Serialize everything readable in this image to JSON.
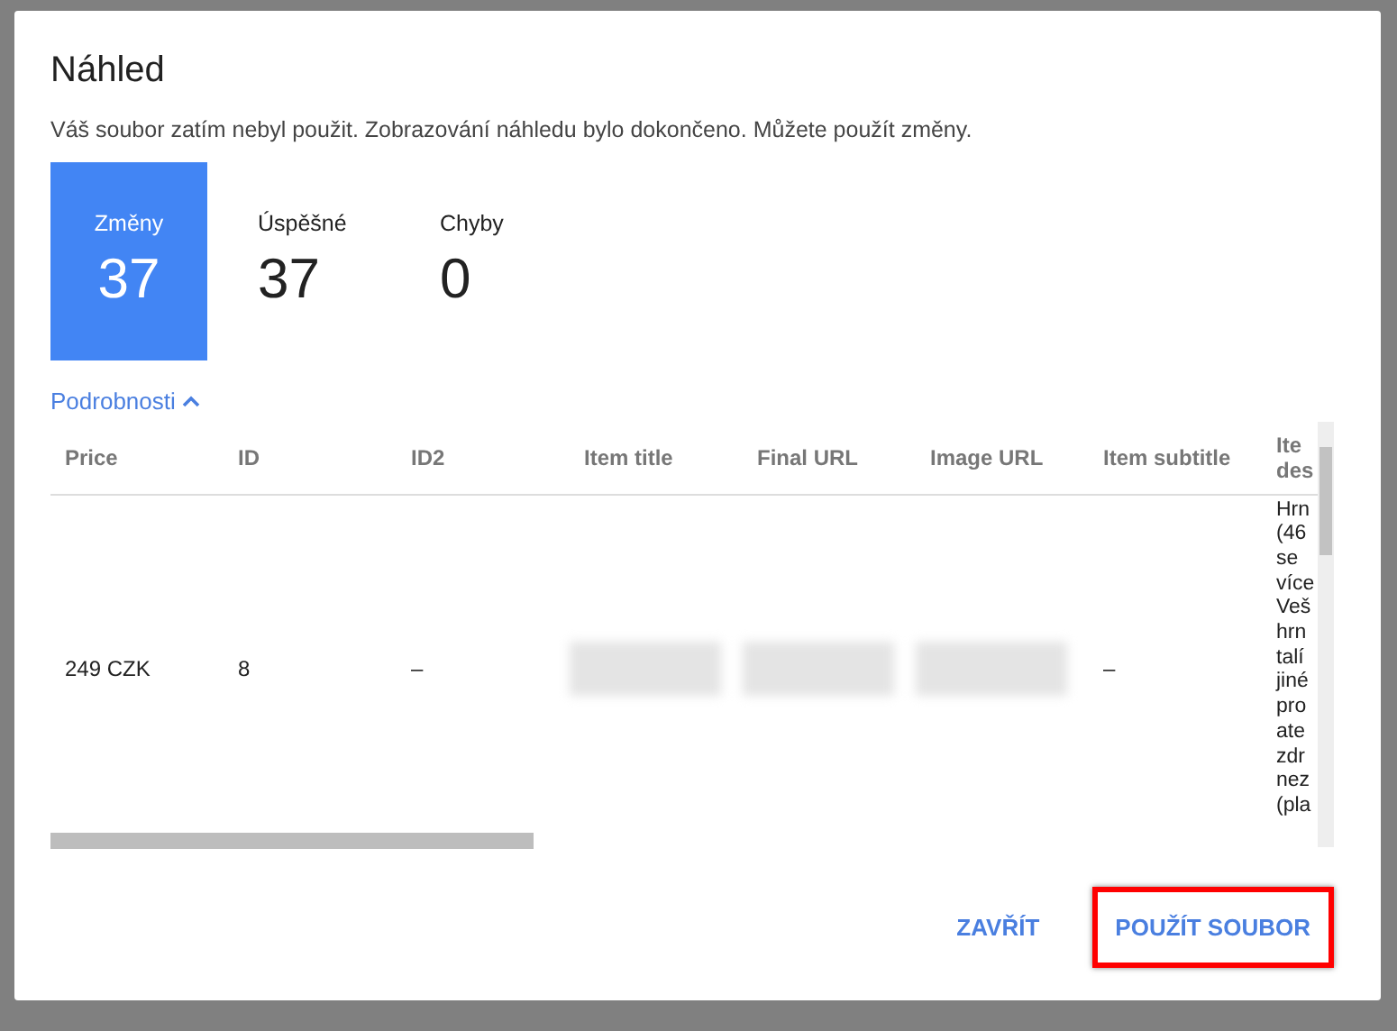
{
  "dialog": {
    "title": "Náhled",
    "message": "Váš soubor zatím nebyl použit. Zobrazování náhledu bylo dokončeno. Můžete použít změny.",
    "stats": [
      {
        "label": "Změny",
        "value": "37",
        "selected": true
      },
      {
        "label": "Úspěšné",
        "value": "37",
        "selected": false
      },
      {
        "label": "Chyby",
        "value": "0",
        "selected": false
      }
    ],
    "details_toggle": {
      "label": "Podrobnosti",
      "expanded": true
    },
    "table": {
      "columns": [
        "Price",
        "ID",
        "ID2",
        "Item title",
        "Final URL",
        "Image URL",
        "Item subtitle",
        "Ite des"
      ],
      "rows": [
        [
          {
            "kind": "text",
            "text": "249 CZK"
          },
          {
            "kind": "text",
            "text": "8"
          },
          {
            "kind": "text",
            "text": "–"
          },
          {
            "kind": "redacted"
          },
          {
            "kind": "redacted"
          },
          {
            "kind": "redacted"
          },
          {
            "kind": "text",
            "text": "–"
          },
          {
            "kind": "text",
            "text": "Hrn (46 se více Veš hrn talí jiné pro ate zdr nez (pla"
          }
        ]
      ]
    },
    "buttons": [
      {
        "label": "ZAVŘÍT",
        "highlighted": false
      },
      {
        "label": "POUŽÍT SOUBOR",
        "highlighted": true
      }
    ]
  }
}
